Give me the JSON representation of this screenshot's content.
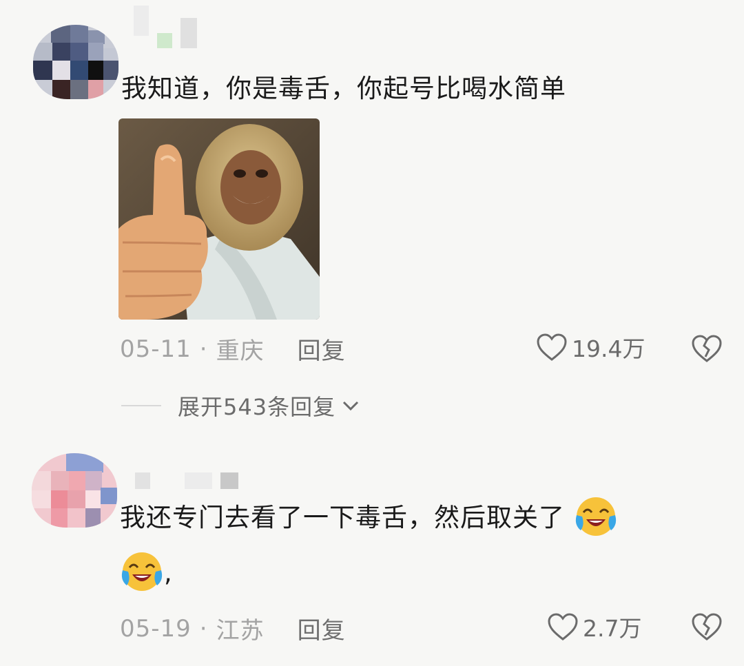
{
  "comments": [
    {
      "text": "我知道，你是毒舌，你起号比喝水简单",
      "date": "05-11",
      "separator": "·",
      "location": "重庆",
      "reply_label": "回复",
      "likes": "19.4万",
      "expand_label": "展开543条回复",
      "image_description": "thumbs-up monkey-king meme"
    },
    {
      "text": "我还专门去看了一下毒舌，然后取关了",
      "text_cont": ",",
      "date": "05-19",
      "separator": "·",
      "location": "江苏",
      "reply_label": "回复",
      "likes": "2.7万"
    }
  ],
  "colors": {
    "background": "#f7f7f5",
    "meta": "#a3a3a3",
    "text": "#1a1a1a"
  },
  "icons": [
    "heart-outline-icon",
    "broken-heart-icon",
    "chevron-down-icon",
    "laughing-crying-emoji"
  ]
}
